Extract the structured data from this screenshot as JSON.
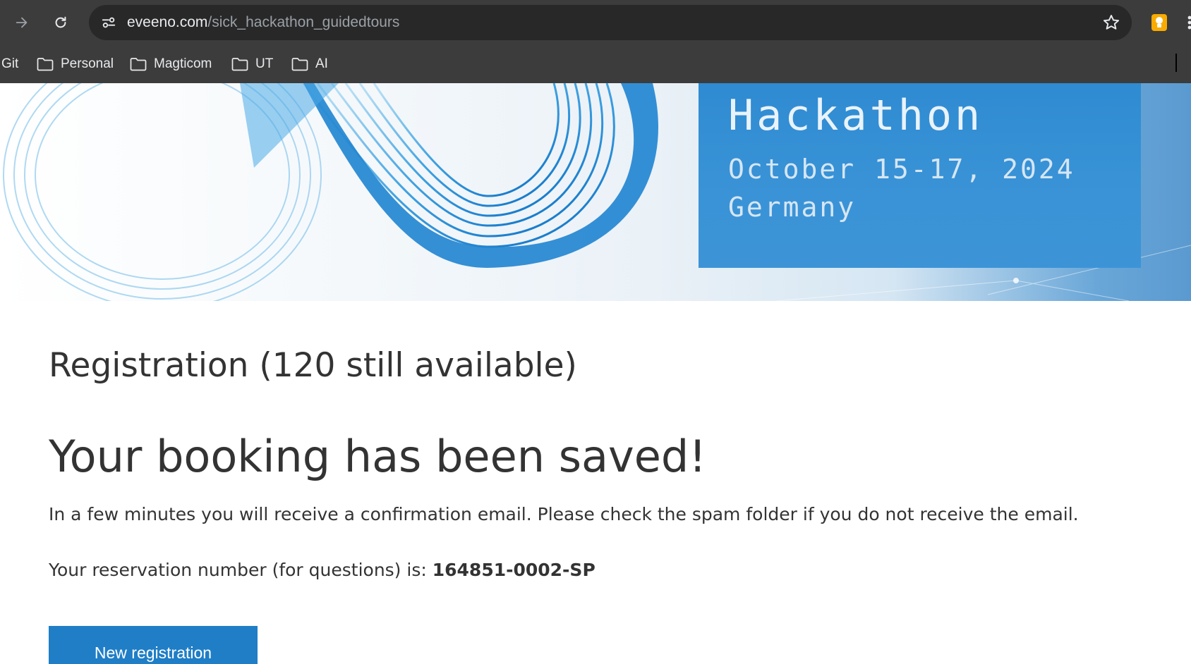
{
  "browser": {
    "url_host": "eveeno.com",
    "url_path": "/sick_hackathon_guidedtours",
    "icons": {
      "forward": "arrow-forward-icon",
      "reload": "reload-icon",
      "site_info": "site-settings-icon",
      "bookmark": "star-icon",
      "extension": "extension-icon"
    },
    "bookmarks": [
      {
        "label": "Git",
        "icon": ""
      },
      {
        "label": "Personal",
        "icon": "folder-icon"
      },
      {
        "label": "Magticom",
        "icon": "folder-icon"
      },
      {
        "label": "UT",
        "icon": "folder-icon"
      },
      {
        "label": "AI",
        "icon": "folder-icon"
      }
    ]
  },
  "banner": {
    "title": "Hackathon",
    "date": "October 15-17, 2024",
    "place": "Germany"
  },
  "registration": {
    "heading": "Registration (120 still available)",
    "booking_heading": "Your booking has been saved!",
    "confirmation_text": "In a few minutes you will receive a confirmation email. Please check the spam folder if you do not receive the email.",
    "reservation_prefix": "Your reservation number (for questions) is: ",
    "reservation_number": "164851-0002-SP",
    "new_registration_label": "New registration"
  },
  "colors": {
    "chrome_bg": "#3c3c3c",
    "omnibox_bg": "#282828",
    "banner_box": "#3a93d6",
    "button_bg": "#1f7ec6",
    "text": "#333333"
  }
}
